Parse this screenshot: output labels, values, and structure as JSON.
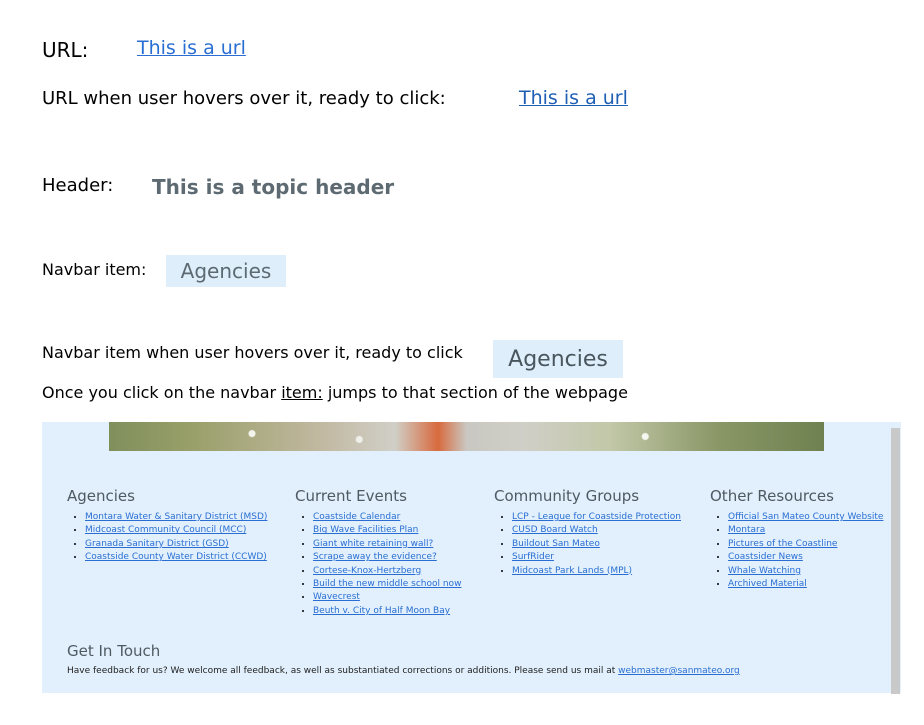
{
  "rows": {
    "url_label": "URL:",
    "url_link": "This is a url",
    "hover_label": "URL when user hovers over it, ready to click:",
    "hover_link": "This is a url",
    "header_label": "Header:",
    "header_value": "This is a topic header",
    "navbar_label": "Navbar item:",
    "navbar_value": "Agencies",
    "navbar_hover_label": "Navbar item when user hovers over it, ready to click",
    "navbar_hover_value": "Agencies",
    "click_pre": "Once you click on the navbar ",
    "click_item": "item:",
    "click_post": " jumps to that section of the webpage"
  },
  "footer": {
    "columns": [
      {
        "title": "Agencies",
        "items": [
          "Montara Water & Sanitary District (MSD)",
          "Midcoast Community Council (MCC)",
          "Granada Sanitary District (GSD)",
          "Coastside County Water District (CCWD)"
        ]
      },
      {
        "title": "Current Events",
        "items": [
          "Coastside Calendar",
          "Big Wave Facilities Plan",
          "Giant white retaining wall?",
          "Scrape away the evidence?",
          "Cortese-Knox-Hertzberg",
          "Build the new middle school now",
          "Wavecrest",
          "Beuth v. City of Half Moon Bay"
        ]
      },
      {
        "title": "Community Groups",
        "items": [
          "LCP - League for Coastside Protection",
          "CUSD Board Watch",
          "Buildout San Mateo",
          "SurfRider",
          "Midcoast Park Lands (MPL)"
        ]
      },
      {
        "title": "Other Resources",
        "items": [
          "Official San Mateo County Website",
          "Montara",
          "Pictures of the Coastline",
          "Coastsider News",
          "Whale Watching",
          "Archived Material"
        ]
      }
    ],
    "get_in_touch_title": "Get In Touch",
    "get_in_touch_text": "Have feedback for us? We welcome all feedback, as well as substantiated corrections or additions. Please send us mail at ",
    "email": "webmaster@sanmateo.org"
  }
}
